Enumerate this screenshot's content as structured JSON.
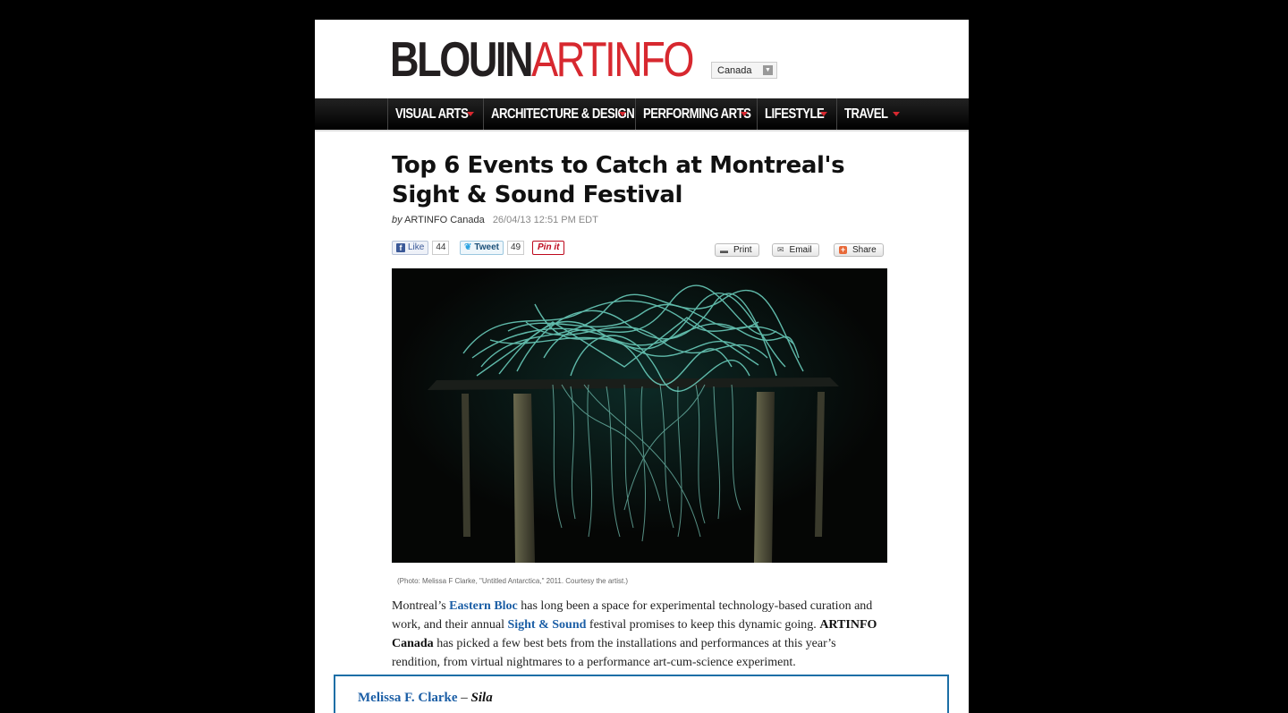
{
  "header": {
    "logo_part1": "BLOUIN",
    "logo_part2": "ARTINFO",
    "region_label": "Canada"
  },
  "nav": {
    "items": [
      {
        "label": "VISUAL ARTS"
      },
      {
        "label": "ARCHITECTURE & DESIGN"
      },
      {
        "label": "PERFORMING ARTS"
      },
      {
        "label": "LIFESTYLE"
      },
      {
        "label": "TRAVEL"
      }
    ]
  },
  "article": {
    "title": "Top 6 Events to Catch at Montreal's Sight & Sound Festival",
    "byline_prefix": "by",
    "author": "ARTINFO Canada",
    "date": "26/04/13 12:51 PM EDT",
    "caption": "(Photo: Melissa F Clarke, \"Untitled Antarctica,\" 2011. Courtesy the artist.)",
    "body": {
      "p1": "Montreal’s ",
      "link1": "Eastern Bloc",
      "p2": " has long been a space for experimental technology-based curation and work, and their annual ",
      "link2": "Sight & Sound",
      "p3": " festival promises to keep this dynamic going. ",
      "bold1": "ARTINFO Canada",
      "p4": " has picked a few best bets from the installations and performances at this year’s rendition, from virtual nightmares to a performance art-cum-science experiment."
    },
    "first_item": {
      "artist": "Melissa F. Clarke",
      "dash": " – ",
      "work": "Sila"
    }
  },
  "social": {
    "like_label": "Like",
    "like_count": "44",
    "tweet_label": "Tweet",
    "tweet_count": "49",
    "pin_label": "Pin it"
  },
  "tools": {
    "print": "Print",
    "email": "Email",
    "share": "Share"
  },
  "colors": {
    "brand_red": "#d7282f",
    "link_blue": "#1c5fa6"
  }
}
